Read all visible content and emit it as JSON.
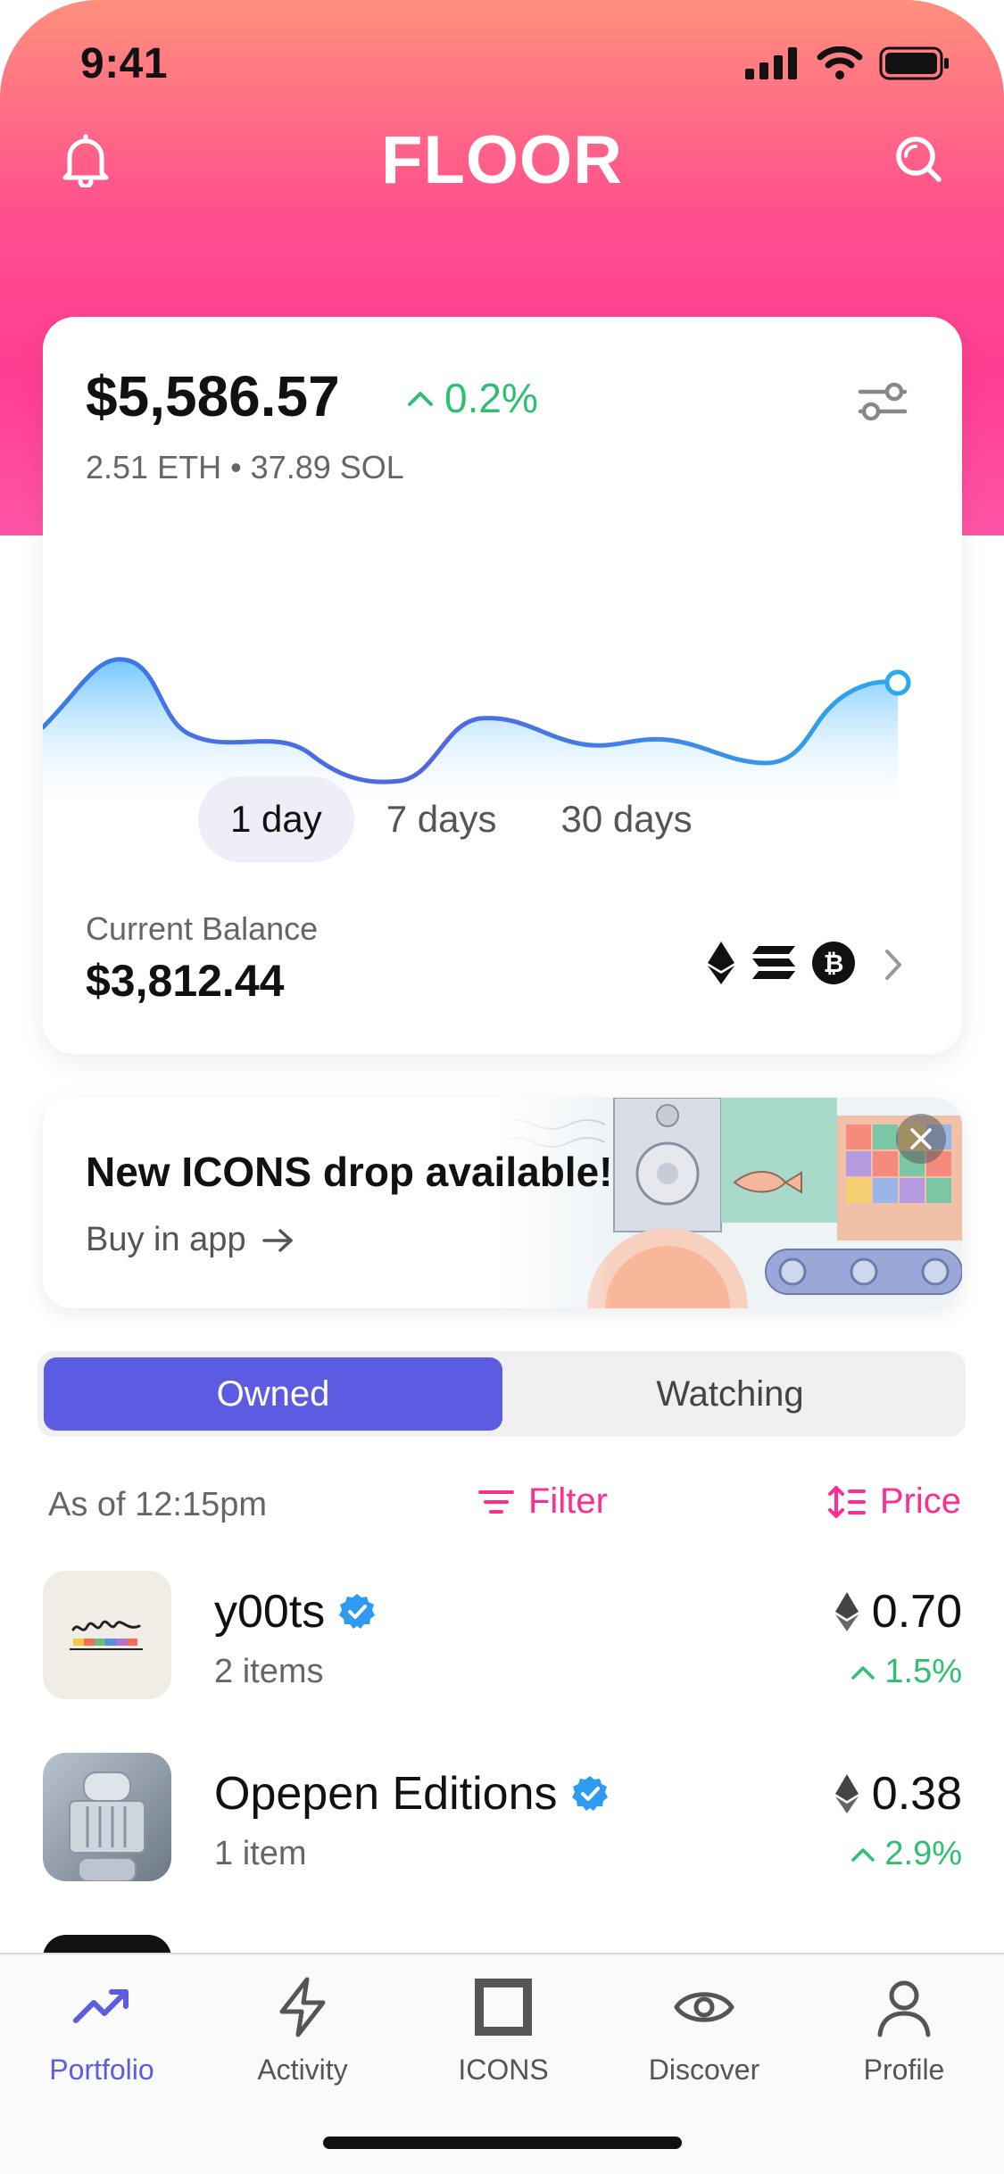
{
  "status_bar": {
    "time": "9:41"
  },
  "header": {
    "logo": "FLOOR"
  },
  "portfolio": {
    "total_value": "$5,586.57",
    "change": "0.2%",
    "holdings": "2.51 ETH • 37.89 SOL",
    "ranges": [
      "1 day",
      "7 days",
      "30 days"
    ],
    "active_range": "1 day",
    "balance_label": "Current Balance",
    "balance_value": "$3,812.44"
  },
  "banner": {
    "title": "New ICONS drop available!",
    "cta": "Buy in app"
  },
  "segments": {
    "owned": "Owned",
    "watching": "Watching"
  },
  "list_header": {
    "as_of": "As of 12:15pm",
    "filter": "Filter",
    "sort": "Price"
  },
  "collections": [
    {
      "name": "y00ts",
      "items": "2 items",
      "floor": "0.70",
      "change": "1.5%",
      "verified": true
    },
    {
      "name": "Opepen Editions",
      "items": "1 item",
      "floor": "0.38",
      "change": "2.9%",
      "verified": true
    }
  ],
  "tabs": [
    {
      "label": "Portfolio",
      "icon": "trending-up-icon",
      "active": true
    },
    {
      "label": "Activity",
      "icon": "lightning-icon",
      "active": false
    },
    {
      "label": "ICONS",
      "icon": "square-icon",
      "active": false
    },
    {
      "label": "Discover",
      "icon": "eye-icon",
      "active": false
    },
    {
      "label": "Profile",
      "icon": "person-icon",
      "active": false
    }
  ],
  "colors": {
    "brand_pink": "#ff3d93",
    "accent_purple": "#5b5ce2",
    "positive_green": "#2fbf71",
    "verified_blue": "#2f9bf0"
  }
}
